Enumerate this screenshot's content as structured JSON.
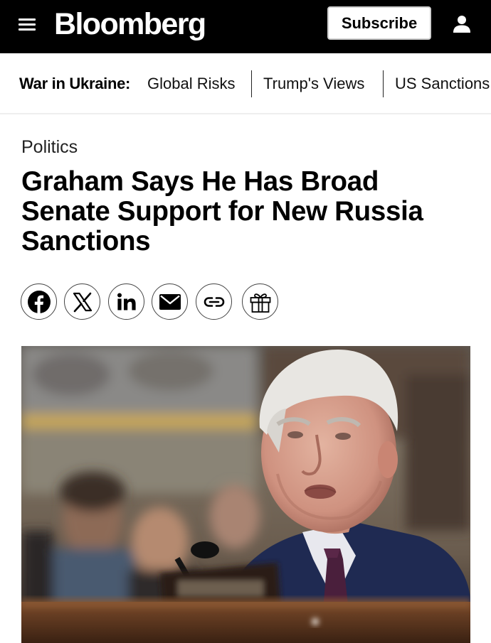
{
  "header": {
    "logo": "Bloomberg",
    "subscribe_label": "Subscribe",
    "menu_icon": "hamburger-menu-icon",
    "account_icon": "user-icon"
  },
  "topic_nav": {
    "label": "War in Ukraine:",
    "items": [
      "Global Risks",
      "Trump's Views",
      "US Sanctions"
    ]
  },
  "article": {
    "section": "Politics",
    "headline": "Graham Says He Has Broad Senate Support for New Russia Sanctions"
  },
  "share_buttons": [
    {
      "icon": "facebook-icon"
    },
    {
      "icon": "x-icon"
    },
    {
      "icon": "linkedin-icon"
    },
    {
      "icon": "email-icon"
    },
    {
      "icon": "link-icon"
    },
    {
      "icon": "gift-icon"
    }
  ],
  "colors": {
    "header_bg": "#000000",
    "text": "#000000",
    "background": "#ffffff"
  }
}
